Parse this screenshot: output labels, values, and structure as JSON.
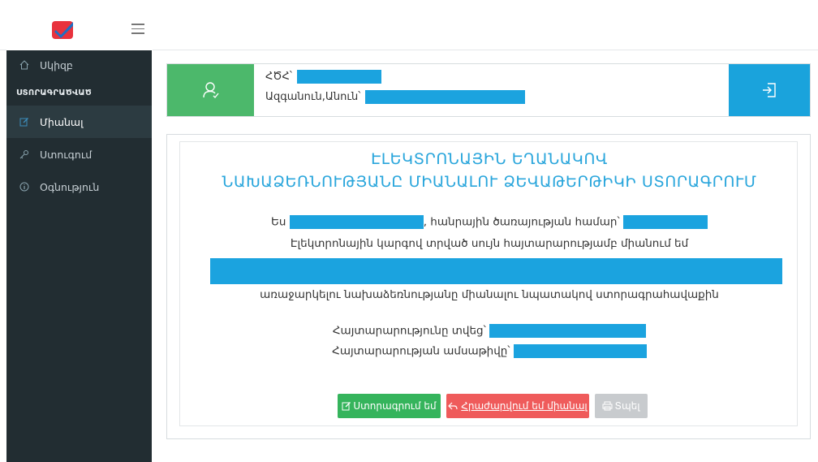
{
  "nav": {
    "home_label": "Սկիզբ",
    "section_header": "ՍՏՈՐԱԳՐԱԾՎԱԾ",
    "items": [
      {
        "label": "Միանալ",
        "icon": "edit-icon",
        "active": true
      },
      {
        "label": "Ստուգում",
        "icon": "key-icon",
        "active": false
      },
      {
        "label": "Օգնություն",
        "icon": "info-icon",
        "active": false
      }
    ]
  },
  "user": {
    "ssn_label": "ՀԾՀ՝",
    "name_label": "Ազգանուն,Անուն՝"
  },
  "document": {
    "title_line1": "ԷԼԵԿՏՐՈՆԱՅԻՆ ԵՂԱՆԱԿՈՎ",
    "title_line2": "ՆԱԽԱՁԵՌՆՈՒԹՅԱՆԸ ՄԻԱՆԱԼՈՒ ՁԵՎԱԹԵՐԹԻԿԻ ՍՏՈՐԱԳՐՈՒՄ",
    "line1_prefix": "Ես",
    "line1_suffix": ", հանրային ծառայության համար՝",
    "line2": "Էլեկտրոնային կարգով տրված սույն հայտարարությամբ միանում եմ",
    "line3": "առաջարկելու նախաձեռնությանը միանալու նպատակով ստորագրահավաքին",
    "declarer_label": "Հայտարարությունը տվեց՝",
    "date_label": "Հայտարարության ամսաթիվը՝"
  },
  "buttons": {
    "sign": "Ստորագրում եմ",
    "decline": "Հրաժարվում եմ միանալ",
    "print": "Տպել"
  },
  "colors": {
    "accent": "#1aa3dc",
    "success": "#4cb86b",
    "danger": "#ef5b5b",
    "sidebar": "#222d32"
  }
}
